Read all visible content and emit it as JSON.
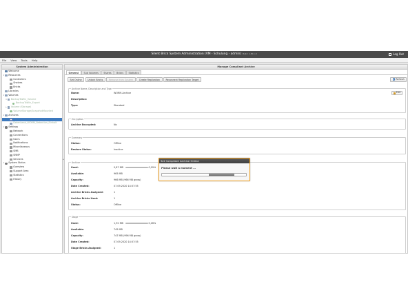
{
  "window": {
    "title": "Silent Brick System Administration (VM - Schulung - admin)",
    "build": "Build: 1.30.1.0",
    "logout_label": "Log Out"
  },
  "menu": [
    "File",
    "View",
    "Tools",
    "Help"
  ],
  "left_panel": {
    "header": "System Administration",
    "tree": [
      {
        "label": "Welcome",
        "indent": 0,
        "icon": "home-icon"
      },
      {
        "label": "Resources",
        "indent": 0,
        "icon": "folder-icon",
        "expand": "▾"
      },
      {
        "label": "Controllers",
        "indent": 2,
        "icon": "controller-icon"
      },
      {
        "label": "Shelves",
        "indent": 2,
        "icon": "shelf-icon"
      },
      {
        "label": "Bricks",
        "indent": 2,
        "icon": "brick-icon"
      },
      {
        "label": "Libraries",
        "indent": 0,
        "icon": "library-icon"
      },
      {
        "label": "Volumes",
        "indent": 0,
        "icon": "volume-icon",
        "expand": "▾"
      },
      {
        "label": "BackupToWin_Volume",
        "indent": 1,
        "icon": "volume-icon",
        "expand": "▾",
        "dim": true
      },
      {
        "label": "BackupToWin_Export",
        "indent": 3,
        "icon": "share-icon",
        "dim": true
      },
      {
        "label": "Volume (Storage)",
        "indent": 1,
        "icon": "volume-icon",
        "expand": "▸",
        "dim": true
      },
      {
        "label": "VolumeStorage/SnapshotMounted",
        "indent": 2,
        "icon": "share-icon",
        "dim": true
      },
      {
        "label": "Archives",
        "indent": 0,
        "icon": "archive-icon",
        "expand": "▾"
      },
      {
        "label": "",
        "indent": 2,
        "icon": "archive-icon",
        "selected": true
      },
      {
        "label": "Datenbank_WORM_Retention_Einhalt",
        "indent": 2,
        "icon": "archive-icon",
        "dim": true
      },
      {
        "label": "Settings",
        "indent": 0,
        "icon": "gear-icon",
        "expand": "▾"
      },
      {
        "label": "Network",
        "indent": 2,
        "icon": "network-icon"
      },
      {
        "label": "Connections",
        "indent": 2,
        "icon": "connections-icon"
      },
      {
        "label": "Users",
        "indent": 2,
        "icon": "users-icon"
      },
      {
        "label": "Notifications",
        "indent": 2,
        "icon": "bell-icon"
      },
      {
        "label": "Miscellaneous",
        "indent": 2,
        "icon": "misc-icon"
      },
      {
        "label": "SMB",
        "indent": 2,
        "icon": "smb-icon"
      },
      {
        "label": "SNMP",
        "indent": 2,
        "icon": "snmp-icon"
      },
      {
        "label": "Services",
        "indent": 2,
        "icon": "services-icon"
      },
      {
        "label": "System Status",
        "indent": 0,
        "icon": "status-icon",
        "expand": "▾"
      },
      {
        "label": "Overview",
        "indent": 2,
        "icon": "overview-icon"
      },
      {
        "label": "Support Area",
        "indent": 2,
        "icon": "support-icon"
      },
      {
        "label": "Statistics",
        "indent": 2,
        "icon": "statistics-icon"
      },
      {
        "label": "History",
        "indent": 2,
        "icon": "history-icon"
      }
    ]
  },
  "main": {
    "header": "Manage Compliant Archive",
    "tabs": [
      "General",
      "Sub Volumes",
      "Shares",
      "Bricks",
      "Statistics"
    ],
    "toolbar": {
      "buttons": [
        {
          "label": "Set Online",
          "disabled": false
        },
        {
          "label": "Unlock Bricks",
          "disabled": false
        },
        {
          "label": "Remove from System",
          "disabled": true
        },
        {
          "label": "Create Replication",
          "disabled": false
        },
        {
          "label": "Reconnect Replication Target",
          "disabled": false
        }
      ],
      "refresh_label": "Refresh"
    },
    "edit_label": "Edit",
    "sections": {
      "name": {
        "legend": "Archive Name, Description and Type",
        "rows": [
          {
            "label": "Name:",
            "value": "WORM-Archive"
          },
          {
            "label": "Description:",
            "value": ""
          },
          {
            "label": "Type:",
            "value": "Standard"
          }
        ]
      },
      "encryption": {
        "legend": "Encryption",
        "rows": [
          {
            "label": "Archive Encrypted:",
            "value": "No"
          }
        ]
      },
      "summary": {
        "legend": "Summary",
        "rows": [
          {
            "label": "Status:",
            "value": "Offline"
          },
          {
            "label": "Restore Status:",
            "value": "Inactive"
          }
        ]
      },
      "archive": {
        "legend": "Archive",
        "rows": [
          {
            "label": "Used:",
            "value": "0,87 MB",
            "percent_text": "0,09%",
            "fill": 0.09
          },
          {
            "label": "Available:",
            "value": "965 MB"
          },
          {
            "label": "Capacity:",
            "value": "966 MB (966 MB gross)"
          },
          {
            "label": "Date Created:",
            "value": "07.09.2020 14:57:55"
          },
          {
            "label": "Archive Bricks Assigned:",
            "value": "1"
          },
          {
            "label": "Archive Bricks Used:",
            "value": "1"
          },
          {
            "label": "Status:",
            "value": "Offline"
          }
        ]
      },
      "stage": {
        "legend": "Stage",
        "rows": [
          {
            "label": "Used:",
            "value": "1,92 MB",
            "percent_text": "0,26%",
            "fill": 0.26
          },
          {
            "label": "Available:",
            "value": "745 MB"
          },
          {
            "label": "Capacity:",
            "value": "747 MB (996 MB gross)"
          },
          {
            "label": "Date Created:",
            "value": "07.09.2020 14:57:55"
          },
          {
            "label": "Stage Bricks Assigned:",
            "value": "1"
          }
        ]
      }
    }
  },
  "modal": {
    "title": "Set Compliant Archive Online",
    "message": "Please wait a moment ...",
    "progress_chunk_start": 0.56,
    "progress_chunk_end": 0.86
  },
  "colors": {
    "titlebar": "#4a4a4a",
    "selection": "#3d79bd",
    "modal_border": "#f0a020",
    "bar_fill": "#5f9ad3"
  }
}
